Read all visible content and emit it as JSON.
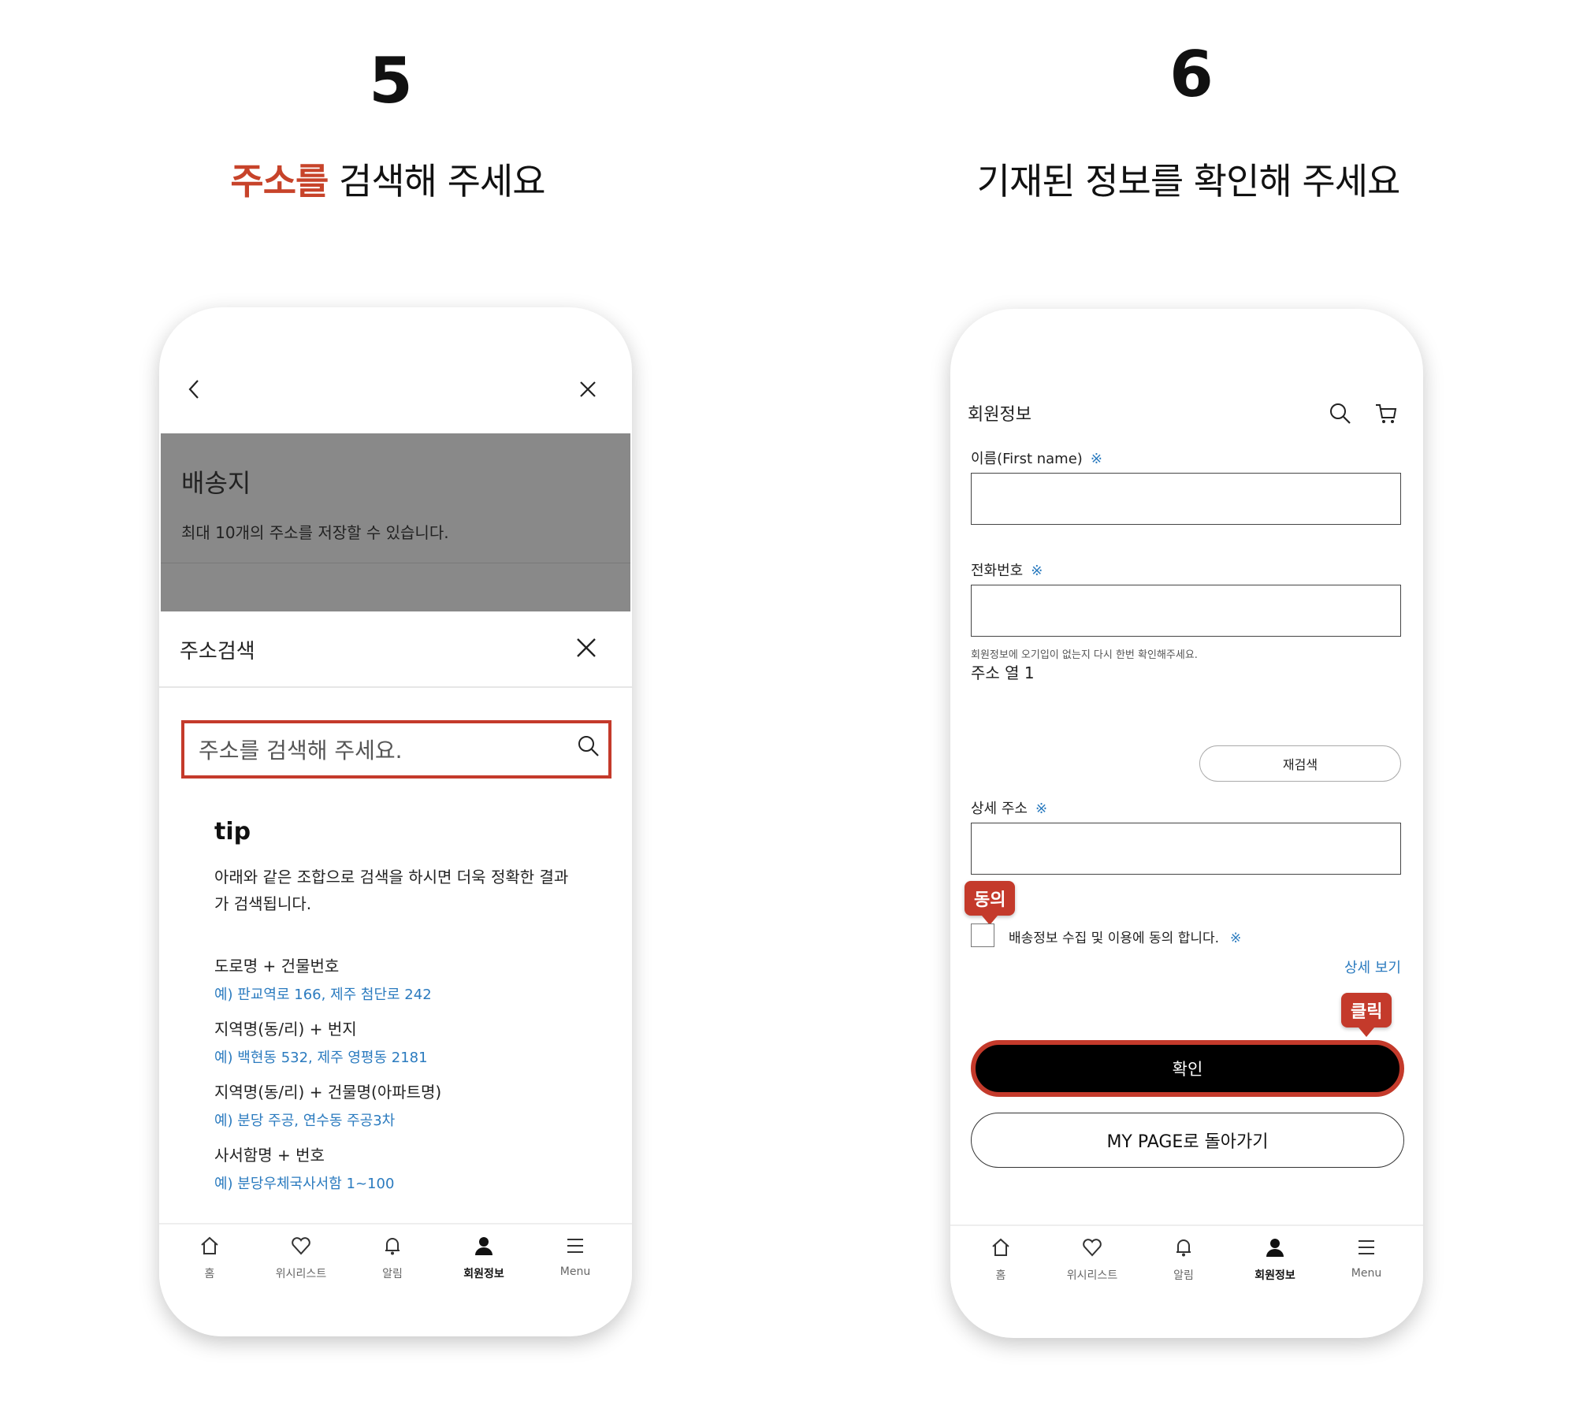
{
  "steps": [
    {
      "number": "5",
      "title_highlight": "주소를",
      "title_rest": " 검색해 주세요"
    },
    {
      "number": "6",
      "title": "기재된 정보를 확인해 주세요"
    }
  ],
  "colors": {
    "accent": "#c43a2b",
    "link": "#2b7bbf",
    "overlay": "#898989"
  },
  "phone1": {
    "back_icon": "chevron-left-icon",
    "close_icon": "close-icon",
    "overlay": {
      "title": "배송지",
      "subtitle": "최대 10개의 주소를 저장할 수 있습니다."
    },
    "sheet": {
      "title": "주소검색",
      "search_placeholder": "주소를 검색해 주세요.",
      "tip_title": "tip",
      "tip_body": "아래와 같은 조합으로 검색을 하시면 더욱 정확한 결과가 검색됩니다.",
      "examples": [
        {
          "label": "도로명 + 건물번호",
          "value": "예) 판교역로 166,  제주 첨단로 242"
        },
        {
          "label": "지역명(동/리) + 번지",
          "value": "예) 백현동 532,  제주 영평동 2181"
        },
        {
          "label": "지역명(동/리) + 건물명(아파트명)",
          "value": "예) 분당 주공,  연수동 주공3차"
        },
        {
          "label": "사서함명 + 번호",
          "value": "예) 분당우체국사서함 1~100"
        }
      ]
    }
  },
  "tabbar": [
    {
      "label": "홈",
      "icon": "home-icon"
    },
    {
      "label": "위시리스트",
      "icon": "heart-icon"
    },
    {
      "label": "알림",
      "icon": "bell-icon"
    },
    {
      "label": "회원정보",
      "icon": "user-icon"
    },
    {
      "label": "Menu",
      "icon": "menu-icon"
    }
  ],
  "phone2": {
    "header_title": "회원정보",
    "fields": {
      "first_name_label": "이름(First name)",
      "phone_label": "전화번호",
      "required_mark": "※",
      "note": "회원정보에 오기입이 없는지 다시 한번 확인해주세요.",
      "address_line": "주소 열 1",
      "research_button": "재검색",
      "detail_address_label": "상세 주소"
    },
    "agree_text": "배송정보 수집 및 이용에 동의 합니다.",
    "detail_link": "상세 보기",
    "callout_agree": "동의",
    "callout_click": "클릭",
    "confirm_button": "확인",
    "mypage_button": "MY PAGE로 돌아가기"
  }
}
